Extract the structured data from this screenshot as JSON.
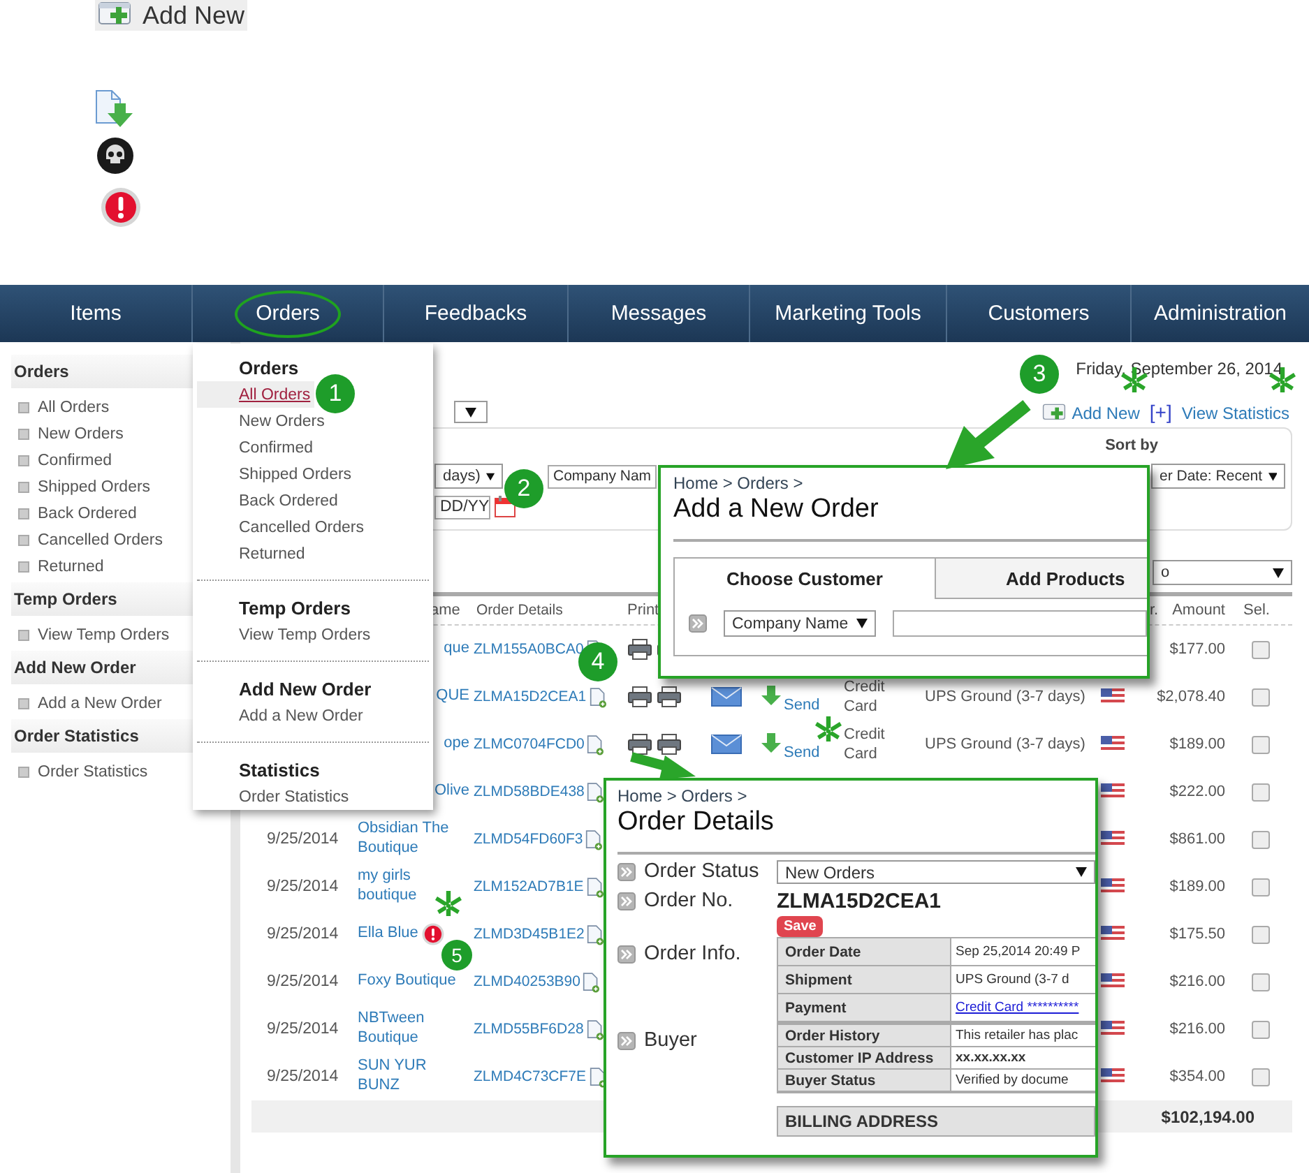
{
  "legend": {
    "add_button": "Add New"
  },
  "nav": [
    {
      "label": "Items",
      "highlighted": false
    },
    {
      "label": "Orders",
      "highlighted": true
    },
    {
      "label": "Feedbacks",
      "highlighted": false
    },
    {
      "label": "Messages",
      "highlighted": false
    },
    {
      "label": "Marketing Tools",
      "highlighted": false
    },
    {
      "label": "Customers",
      "highlighted": false
    },
    {
      "label": "Administration",
      "highlighted": false
    }
  ],
  "sidebar": [
    {
      "heading": "Orders",
      "items": [
        "All Orders",
        "New Orders",
        "Confirmed",
        "Shipped Orders",
        "Back Ordered",
        "Cancelled Orders",
        "Returned"
      ]
    },
    {
      "heading": "Temp Orders",
      "items": [
        "View Temp Orders"
      ]
    },
    {
      "heading": "Add New Order",
      "items": [
        "Add a New Order"
      ]
    },
    {
      "heading": "Order Statistics",
      "items": [
        "Order Statistics"
      ]
    }
  ],
  "menu": [
    {
      "heading": "Orders",
      "items": [
        {
          "label": "All Orders",
          "selected": true
        },
        {
          "label": "New Orders",
          "selected": false
        },
        {
          "label": "Confirmed",
          "selected": false
        },
        {
          "label": "Shipped Orders",
          "selected": false
        },
        {
          "label": "Back Ordered",
          "selected": false
        },
        {
          "label": "Cancelled Orders",
          "selected": false
        },
        {
          "label": "Returned",
          "selected": false
        }
      ]
    },
    {
      "heading": "Temp Orders",
      "items": [
        {
          "label": "View Temp Orders",
          "selected": false
        }
      ]
    },
    {
      "heading": "Add New Order",
      "items": [
        {
          "label": "Add a New Order",
          "selected": false
        }
      ]
    },
    {
      "heading": "Statistics",
      "items": [
        {
          "label": "Order Statistics",
          "selected": false
        }
      ]
    }
  ],
  "toolbar": {
    "date": "Friday, September 26, 2014",
    "add_new": "Add New",
    "stats_mark": "[+]",
    "view_statistics": "View Statistics"
  },
  "filters": {
    "period": "days)",
    "search_by": "Company Nam",
    "date_field": "DD/YY",
    "sort_label": "Sort by",
    "sort_value": "er Date: Recent",
    "page_size": "o"
  },
  "table": {
    "columns": [
      "ame",
      "Order Details",
      "Print",
      "r.",
      "Amount",
      "Sel."
    ],
    "rows": [
      {
        "name": "que",
        "order_id": "ZLM155A0BCA0",
        "print": true,
        "flag": false,
        "amount": "$177.00",
        "selected": false
      },
      {
        "name": "QUE",
        "order_id": "ZLMA15D2CEA1",
        "print": true,
        "send": "Send",
        "payment": "Credit Card",
        "shipping": "UPS Ground (3-7 days)",
        "flag": true,
        "amount": "$2,078.40",
        "selected": false
      },
      {
        "name": "ope",
        "order_id": "ZLMC0704FCD0",
        "print": true,
        "send": "Send",
        "payment": "Credit Card",
        "shipping": "UPS Ground (3-7 days)",
        "flag": true,
        "amount": "$189.00",
        "selected": false
      },
      {
        "name": "Olive",
        "order_id": "ZLMD58BDE438",
        "print": false,
        "flag": true,
        "amount": "$222.00",
        "selected": false
      },
      {
        "date": "9/25/2014",
        "name": "Obsidian The Boutique",
        "order_id": "ZLMD54FD60F3",
        "print": false,
        "flag": true,
        "amount": "$861.00",
        "selected": false
      },
      {
        "date": "9/25/2014",
        "name": "my girls boutique",
        "order_id": "ZLM152AD7B1E",
        "print": false,
        "flag": true,
        "amount": "$189.00",
        "selected": false
      },
      {
        "date": "9/25/2014",
        "name": "Ella Blue",
        "alert": true,
        "order_id": "ZLMD3D45B1E2",
        "print": false,
        "flag": true,
        "amount": "$175.50",
        "selected": false
      },
      {
        "date": "9/25/2014",
        "name": "Foxy Boutique",
        "order_id": "ZLMD40253B90",
        "print": false,
        "flag": true,
        "amount": "$216.00",
        "selected": false
      },
      {
        "date": "9/25/2014",
        "name": "NBTween Boutique",
        "order_id": "ZLMD55BF6D28",
        "print": false,
        "flag": true,
        "amount": "$216.00",
        "selected": false
      },
      {
        "date": "9/25/2014",
        "name": "SUN YUR BUNZ",
        "order_id": "ZLMD4C73CF7E",
        "print": false,
        "flag": true,
        "amount": "$354.00",
        "selected": false
      }
    ],
    "total": "$102,194.00"
  },
  "add_order_popup": {
    "breadcrumb": "Home > Orders >",
    "title": "Add a New Order",
    "tabs": [
      {
        "label": "Choose Customer",
        "selected": true
      },
      {
        "label": "Add Products",
        "selected": false
      }
    ],
    "search_by": "Company Name"
  },
  "order_details_popup": {
    "breadcrumb": "Home > Orders >",
    "title": "Order Details",
    "status_label": "Order Status",
    "status_value": "New Orders",
    "number_label": "Order No.",
    "number": "ZLMA15D2CEA1",
    "save": "Save",
    "info_label": "Order Info.",
    "info": [
      {
        "label": "Order Date",
        "value": "Sep 25,2014 20:49 P",
        "kind": "text"
      },
      {
        "label": "Shipment",
        "value": "UPS Ground (3-7 d",
        "kind": "text"
      },
      {
        "label": "Payment",
        "value": "Credit Card **********",
        "kind": "link"
      }
    ],
    "buyer_label": "Buyer",
    "buyer": [
      {
        "label": "Order History",
        "value": "This retailer has plac",
        "kind": "text"
      },
      {
        "label": "Customer IP Address",
        "value": "xx.xx.xx.xx",
        "kind": "bold"
      },
      {
        "label": "Buyer Status",
        "value": "Verified by docume",
        "kind": "text"
      }
    ],
    "billing": "BILLING ADDRESS"
  },
  "callouts": [
    "1",
    "2",
    "3",
    "4",
    "5"
  ]
}
